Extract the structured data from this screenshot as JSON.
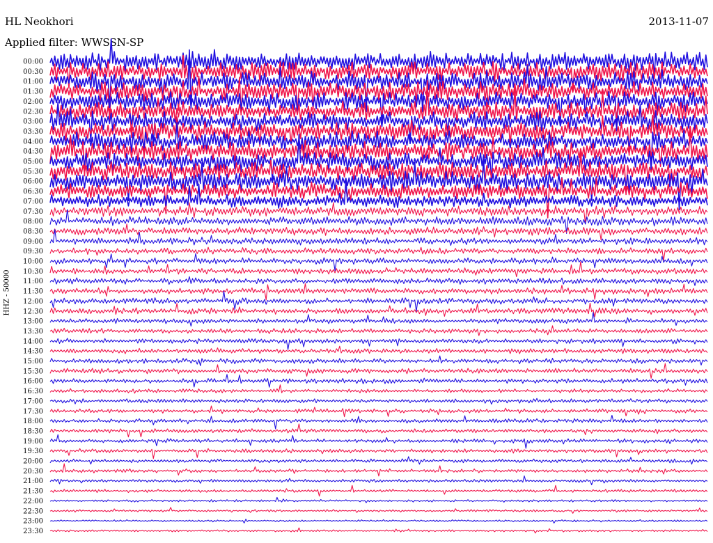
{
  "header": {
    "station": "HL Neokhori",
    "filter": "Applied filter: WWSSN-SP",
    "date": "2013-11-07"
  },
  "side_label": "HHZ - 50000",
  "chart_data": {
    "type": "line",
    "description_kind": "helicorder",
    "rows": [
      "00:00",
      "00:30",
      "01:00",
      "01:30",
      "02:00",
      "02:30",
      "03:00",
      "03:30",
      "04:00",
      "04:30",
      "05:00",
      "05:30",
      "06:00",
      "06:30",
      "07:00",
      "07:30",
      "08:00",
      "08:30",
      "09:00",
      "09:30",
      "10:00",
      "10:30",
      "11:00",
      "11:30",
      "12:00",
      "12:30",
      "13:00",
      "13:30",
      "14:00",
      "14:30",
      "15:00",
      "15:30",
      "16:00",
      "16:30",
      "17:00",
      "17:30",
      "18:00",
      "18:30",
      "19:00",
      "19:30",
      "20:00",
      "20:30",
      "21:00",
      "21:30",
      "22:00",
      "22:30",
      "23:00",
      "23:30"
    ],
    "colors": [
      "#1f0fe0",
      "#f0144a"
    ],
    "background": "#ffffff",
    "noise_level": [
      9,
      9,
      9,
      9,
      9,
      9,
      9,
      9,
      9,
      9,
      9,
      9,
      9,
      8,
      6,
      5,
      4.5,
      4,
      3.5,
      3,
      3,
      3,
      3,
      3,
      3,
      3,
      2.5,
      2.5,
      2.5,
      2.5,
      2.5,
      2.5,
      2.5,
      2,
      2,
      2,
      2,
      2,
      2,
      2,
      1.8,
      1.8,
      1.5,
      1.5,
      1.2,
      1.2,
      1,
      1
    ]
  }
}
